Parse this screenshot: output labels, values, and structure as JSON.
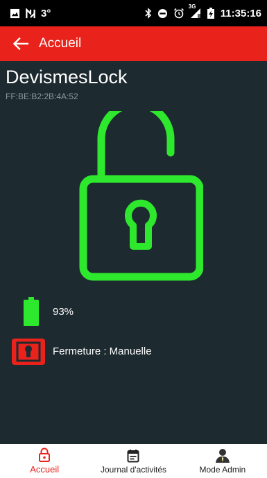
{
  "status_bar": {
    "signal_number": "3°",
    "network": "3G",
    "time": "11:35:16",
    "icons": [
      "image-icon",
      "nfc-icon",
      "bluetooth-icon",
      "do-not-disturb-icon",
      "alarm-icon",
      "signal-icon",
      "battery-status-icon"
    ]
  },
  "app_bar": {
    "title": "Accueil",
    "back_icon": "arrow-left-icon",
    "color": "#e9231c"
  },
  "device": {
    "name": "DevismesLock",
    "mac": "FF:BE:B2:2B:4A:52",
    "lock_state_icon": "unlocked-padlock-icon",
    "lock_color": "#2ee82e"
  },
  "battery": {
    "percent_text": "93%",
    "level": 0.93,
    "icon": "battery-icon"
  },
  "closure": {
    "text": "Fermeture : Manuelle",
    "icon": "manual-lock-icon"
  },
  "bottom_nav": {
    "active": "Accueil",
    "items": [
      {
        "label": "Accueil",
        "icon": "padlock-icon"
      },
      {
        "label": "Journal d'activités",
        "icon": "calendar-icon"
      },
      {
        "label": "Mode Admin",
        "icon": "admin-user-icon"
      }
    ]
  }
}
